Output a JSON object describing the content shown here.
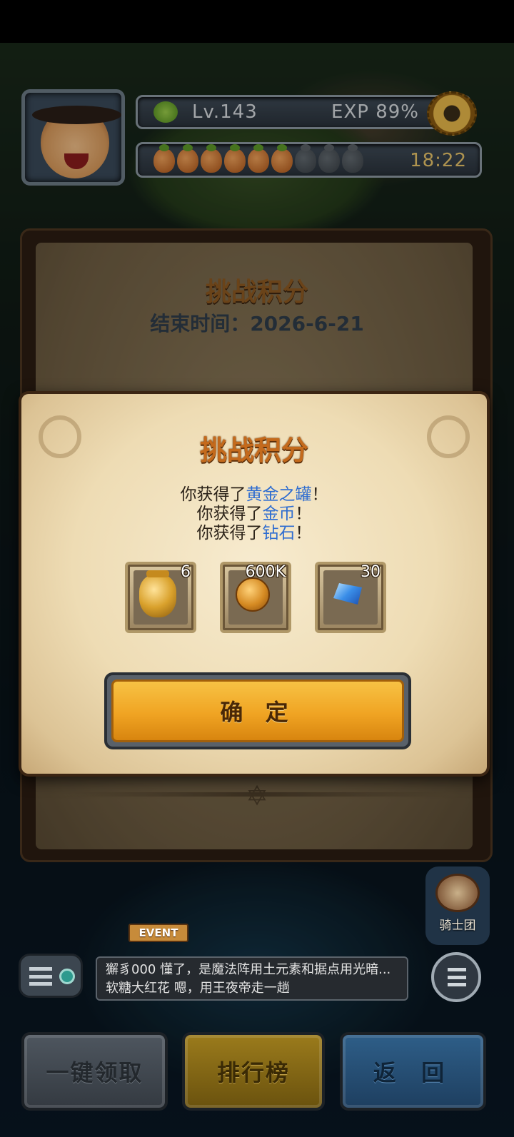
{
  "hud": {
    "level": "Lv.143",
    "exp": "EXP 89%",
    "timer": "18:22",
    "stamina_full": 6,
    "stamina_total": 9
  },
  "background_panel": {
    "title": "挑战积分",
    "end_time": "结束时间：2026-6-21"
  },
  "modal": {
    "title": "挑战积分",
    "messages": [
      {
        "prefix": "你获得了",
        "item": "黄金之罐",
        "suffix": "！"
      },
      {
        "prefix": "你获得了",
        "item": "金币",
        "suffix": "！"
      },
      {
        "prefix": "你获得了",
        "item": "钻石",
        "suffix": "！"
      }
    ],
    "rewards": [
      {
        "icon": "golden-jar-icon",
        "count": "6"
      },
      {
        "icon": "gold-coin-icon",
        "count": "600K"
      },
      {
        "icon": "diamond-icon",
        "count": "30"
      }
    ],
    "confirm_label": "确 定"
  },
  "map_ui": {
    "knights_label": "骑士团",
    "event_label": "EVENT"
  },
  "chat": {
    "lines": [
      {
        "user": "獬豸000",
        "text": "懂了，是魔法阵用土元素和据点用光暗..."
      },
      {
        "user": "软糖大红花",
        "text": "嗯，用王夜帝走一趟"
      }
    ]
  },
  "bottom_bar": {
    "claim_all": "一键领取",
    "ranking": "排行榜",
    "back": "返 回"
  },
  "colors": {
    "highlight_text": "#2f6dd0",
    "title_orange": "#c46a1c",
    "confirm_gold": "#f0a423",
    "timer_gold": "#e8c46a"
  }
}
